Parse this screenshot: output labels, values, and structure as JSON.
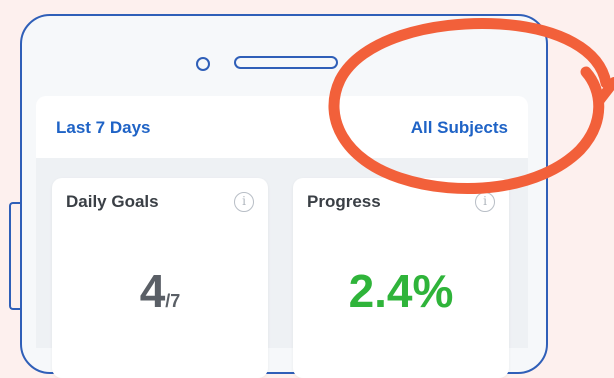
{
  "header": {
    "range_label": "Last 7 Days",
    "subject_filter_label": "All Subjects"
  },
  "cards": {
    "daily_goals": {
      "title": "Daily Goals",
      "value": "4",
      "denominator": "/7"
    },
    "progress": {
      "title": "Progress",
      "value": "2.4%"
    },
    "info_glyph": "i"
  },
  "colors": {
    "background": "#fdf0ee",
    "phone_outline": "#2f5fb8",
    "accent_blue": "#1f63c6",
    "progress_green": "#2fb43a",
    "annotation_orange": "#f2603a"
  },
  "icons": [
    "camera-icon",
    "speaker-icon",
    "info-icon",
    "orange-circle-annotation"
  ]
}
